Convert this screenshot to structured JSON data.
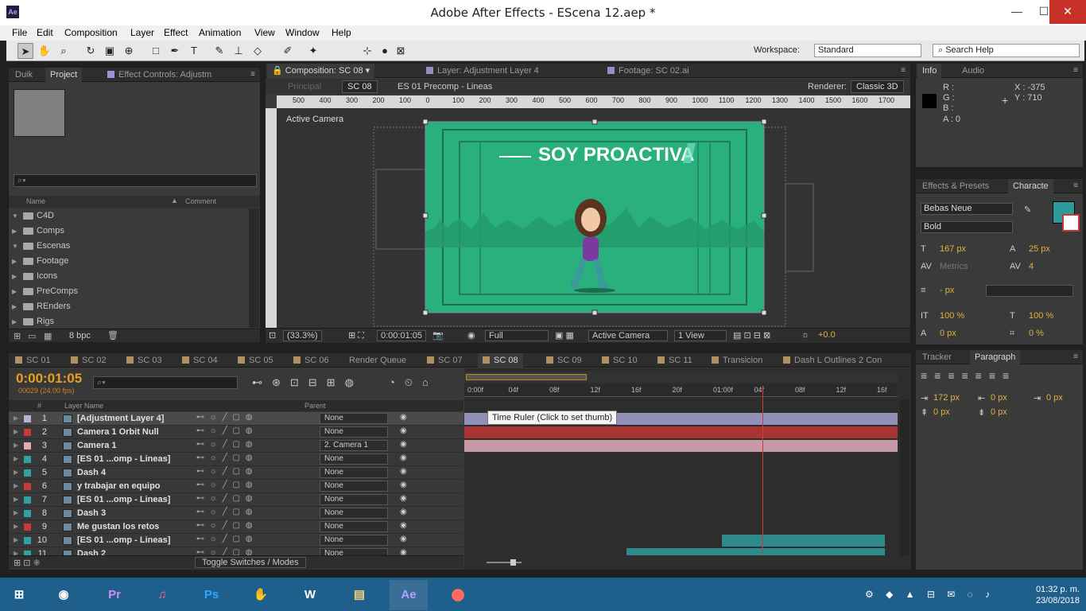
{
  "window": {
    "title": "Adobe After Effects - EScena 12.aep *",
    "app_icon": "Ae",
    "min": "—",
    "max": "☐",
    "close": "✕"
  },
  "menu": [
    "File",
    "Edit",
    "Composition",
    "Layer",
    "Effect",
    "Animation",
    "View",
    "Window",
    "Help"
  ],
  "toolbar": {
    "workspace_label": "Workspace:",
    "workspace_value": "Standard",
    "search_help": "Search Help"
  },
  "project_panel": {
    "tabs": [
      "Duik",
      "Project",
      "Effect Controls: Adjustm"
    ],
    "columns": {
      "name": "Name",
      "comment": "Comment"
    },
    "folders": [
      "C4D",
      "Comps",
      "Escenas",
      "Footage",
      "Icons",
      "PreComps",
      "REnders",
      "Rigs"
    ],
    "bpc": "8 bpc"
  },
  "comp_panel": {
    "tabs": [
      "Composition: SC 08",
      "Layer: Adjustment Layer 4",
      "Footage: SC 02.ai"
    ],
    "breadcrumb": [
      "Principal",
      "SC 08",
      "ES 01 Precomp - Lineas"
    ],
    "renderer_label": "Renderer:",
    "renderer_value": "Classic 3D",
    "view_label": "Active Camera",
    "ruler_ticks": [
      "500",
      "400",
      "300",
      "200",
      "100",
      "0",
      "100",
      "200",
      "300",
      "400",
      "500",
      "600",
      "700",
      "800",
      "900",
      "1000",
      "1100",
      "1200",
      "1300",
      "1400",
      "1500",
      "1600",
      "1700"
    ],
    "canvas_title": "SOY PROACTIVA",
    "footer": {
      "zoom": "(33.3%)",
      "timecode": "0:00:01:05",
      "resolution": "Full",
      "camera": "Active Camera",
      "views": "1 View",
      "exposure": "+0.0"
    },
    "colors": {
      "canvas": "#2ab07c",
      "frame": "#1e6e50"
    }
  },
  "info_panel": {
    "tabs": [
      "Info",
      "Audio"
    ],
    "r": "R :",
    "g": "G :",
    "b": "B :",
    "a": "A : 0",
    "x": "X : -375",
    "y": "Y : 710"
  },
  "effects_panel": {
    "tabs": [
      "Effects & Presets",
      "Characte"
    ],
    "font": "Bebas Neue",
    "style": "Bold",
    "size": "167 px",
    "leading": "25 px",
    "kerning": "Metrics",
    "tracking": "4",
    "stroke": "- px",
    "vscale": "100 %",
    "hscale": "100 %",
    "baseline": "0 px",
    "tsume": "0 %",
    "fill_color": "#2a9a9a"
  },
  "paragraph_panel": {
    "tabs": [
      "Tracker",
      "Paragraph"
    ],
    "indent_left": "172 px",
    "indent_first": "0 px",
    "indent_right": "0 px",
    "space_before": "0 px",
    "space_after": "0 px"
  },
  "timeline": {
    "tabs": [
      "SC 01",
      "SC 02",
      "SC 03",
      "SC 04",
      "SC 05",
      "SC 06",
      "Render Queue",
      "SC 07",
      "SC 08",
      "SC 09",
      "SC 10",
      "SC 11",
      "Transicion",
      "Dash L Outlines 2 Con"
    ],
    "timecode": "0:00:01:05",
    "fps": "00029 (24.00 fps)",
    "columns": {
      "hash": "#",
      "layer_name": "Layer Name",
      "parent": "Parent"
    },
    "ruler": [
      "0:00f",
      "04f",
      "08f",
      "12f",
      "16f",
      "20f",
      "01:00f",
      "04f",
      "08f",
      "12f",
      "16f"
    ],
    "tooltip": "Time Ruler (Click to set thumb)",
    "toggle": "Toggle Switches / Modes",
    "layers": [
      {
        "num": "1",
        "name": "[Adjustment Layer 4]",
        "parent": "None",
        "color": "#b4b4d8"
      },
      {
        "num": "2",
        "name": "Camera 1 Orbit Null",
        "parent": "None",
        "color": "#c83a3a"
      },
      {
        "num": "3",
        "name": "Camera 1",
        "parent": "2. Camera 1",
        "color": "#e8a8b8"
      },
      {
        "num": "4",
        "name": "[ES 01 ...omp - Lineas]",
        "parent": "None",
        "color": "#30a0a0"
      },
      {
        "num": "5",
        "name": "Dash 4",
        "parent": "None",
        "color": "#30a0a0"
      },
      {
        "num": "6",
        "name": "y trabajar en equipo",
        "parent": "None",
        "color": "#c83a3a"
      },
      {
        "num": "7",
        "name": "[ES 01 ...omp - Lineas]",
        "parent": "None",
        "color": "#30a0a0"
      },
      {
        "num": "8",
        "name": "Dash 3",
        "parent": "None",
        "color": "#30a0a0"
      },
      {
        "num": "9",
        "name": "Me gustan los retos",
        "parent": "None",
        "color": "#c83a3a"
      },
      {
        "num": "10",
        "name": "[ES 01 ...omp - Lineas]",
        "parent": "None",
        "color": "#30a0a0"
      },
      {
        "num": "11",
        "name": "Dash 2",
        "parent": "None",
        "color": "#30a0a0"
      }
    ]
  },
  "taskbar": {
    "apps": [
      "Pr",
      "Ps",
      "W",
      "Ae"
    ],
    "time": "01:32 p. m.",
    "date": "23/08/2018"
  }
}
